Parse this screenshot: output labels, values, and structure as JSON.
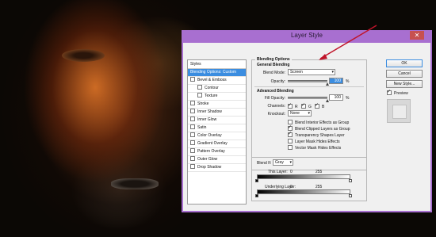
{
  "dialog": {
    "title": "Layer Style",
    "close_glyph": "✕"
  },
  "styles_panel": {
    "header": "Styles",
    "items": [
      {
        "label": "Blending Options: Custom",
        "selected": true,
        "checkbox": false
      },
      {
        "label": "Bevel & Emboss",
        "checkbox": true
      },
      {
        "label": "Contour",
        "checkbox": true,
        "sub": true
      },
      {
        "label": "Texture",
        "checkbox": true,
        "sub": true
      },
      {
        "label": "Stroke",
        "checkbox": true
      },
      {
        "label": "Inner Shadow",
        "checkbox": true
      },
      {
        "label": "Inner Glow",
        "checkbox": true
      },
      {
        "label": "Satin",
        "checkbox": true
      },
      {
        "label": "Color Overlay",
        "checkbox": true
      },
      {
        "label": "Gradient Overlay",
        "checkbox": true
      },
      {
        "label": "Pattern Overlay",
        "checkbox": true
      },
      {
        "label": "Outer Glow",
        "checkbox": true
      },
      {
        "label": "Drop Shadow",
        "checkbox": true
      }
    ]
  },
  "blending_options": {
    "group_title": "Blending Options",
    "general_title": "General Blending",
    "blend_mode_label": "Blend Mode:",
    "blend_mode_value": "Screen",
    "opacity_label": "Opacity:",
    "opacity_value": "100",
    "opacity_unit": "%",
    "opacity_level": 1.0
  },
  "advanced_blending": {
    "title": "Advanced Blending",
    "fill_opacity_label": "Fill Opacity:",
    "fill_opacity_value": "100",
    "fill_opacity_unit": "%",
    "fill_opacity_level": 1.0,
    "channels_label": "Channels:",
    "channels": [
      {
        "label": "R",
        "checked": true
      },
      {
        "label": "G",
        "checked": true
      },
      {
        "label": "B",
        "checked": true
      }
    ],
    "knockout_label": "Knockout:",
    "knockout_value": "None",
    "options": [
      {
        "label": "Blend Interior Effects as Group",
        "checked": false
      },
      {
        "label": "Blend Clipped Layers as Group",
        "checked": true
      },
      {
        "label": "Transparency Shapes Layer",
        "checked": true
      },
      {
        "label": "Layer Mask Hides Effects",
        "checked": false
      },
      {
        "label": "Vector Mask Hides Effects",
        "checked": false
      }
    ]
  },
  "blend_if": {
    "label": "Blend If:",
    "value": "Gray",
    "this_layer_label": "This Layer:",
    "this_layer_low": "0",
    "this_layer_high": "255",
    "underlying_label": "Underlying Layer:",
    "underlying_low": "0",
    "underlying_high": "255"
  },
  "buttons": {
    "ok": "OK",
    "cancel": "Cancel",
    "new_style": "New Style...",
    "preview_label": "Preview",
    "preview_checked": true
  },
  "colors": {
    "window_frame": "#a86fd0",
    "selection": "#3b8de0",
    "close_button": "#c75050",
    "annotation_arrow": "#c0142a"
  }
}
